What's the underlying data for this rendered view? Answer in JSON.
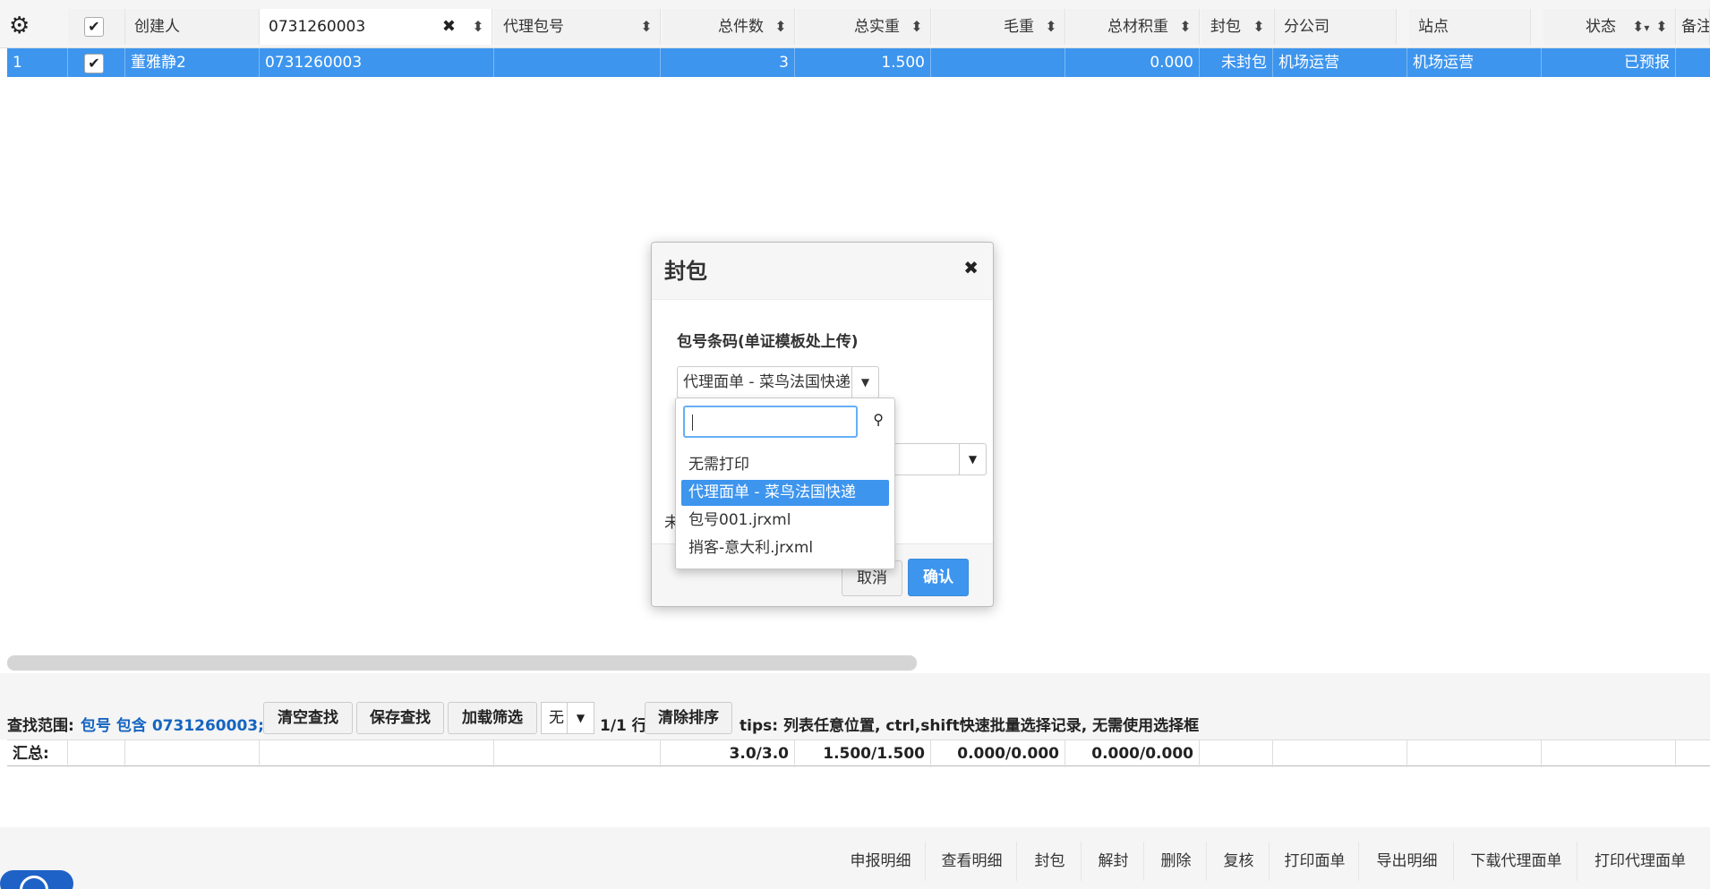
{
  "header": {
    "settings_icon": "gear-icon",
    "columns": {
      "creator": "创建人",
      "filter_value": "0731260003",
      "agent_pkg": "代理包号",
      "total_pieces": "总件数",
      "total_weight": "总实重",
      "gross_weight": "毛重",
      "vol_weight": "总材积重",
      "sealed": "封包",
      "branch": "分公司",
      "site": "站点",
      "status": "状态",
      "remark": "备注"
    }
  },
  "row": {
    "index": "1",
    "creator": "董雅静2",
    "package_no": "0731260003",
    "agent_pkg": "",
    "total_pieces": "3",
    "total_weight": "1.500",
    "gross_weight": "",
    "vol_weight": "0.000",
    "sealed": "未封包",
    "branch": "机场运营",
    "site": "机场运营",
    "status": "已预报"
  },
  "modal": {
    "title": "封包",
    "field_label": "包号条码(单证模板处上传)",
    "selected_template": "代理面单 - 菜鸟法国快递",
    "partial_text": "未",
    "cancel_label": "取消",
    "ok_label": "确认"
  },
  "dropdown": {
    "search_value": "",
    "options": [
      {
        "label": "无需打印",
        "selected": false
      },
      {
        "label": "代理面单 - 菜鸟法国快递",
        "selected": true
      },
      {
        "label": "包号001.jrxml",
        "selected": false
      },
      {
        "label": "捎客-意大利.jrxml",
        "selected": false
      }
    ]
  },
  "toolbar": {
    "scope_label": "查找范围:",
    "scope_value": "包号 包含 0731260003;",
    "clear_search": "清空查找",
    "save_search": "保存查找",
    "load_filter": "加载筛选",
    "filter_select": "无",
    "row_count": "1/1 行",
    "clear_sort": "清除排序",
    "tips": "tips: 列表任意位置, ctrl,shift快速批量选择记录, 无需使用选择框"
  },
  "summary": {
    "label": "汇总:",
    "pieces": "3.0/3.0",
    "weight": "1.500/1.500",
    "gross": "0.000/0.000",
    "vol": "0.000/0.000"
  },
  "actions": [
    "申报明细",
    "查看明细",
    "封包",
    "解封",
    "删除",
    "复核",
    "打印面单",
    "导出明细",
    "下载代理面单",
    "打印代理面单"
  ],
  "colors": {
    "accent": "#3d95ee",
    "link": "#1565c0"
  }
}
